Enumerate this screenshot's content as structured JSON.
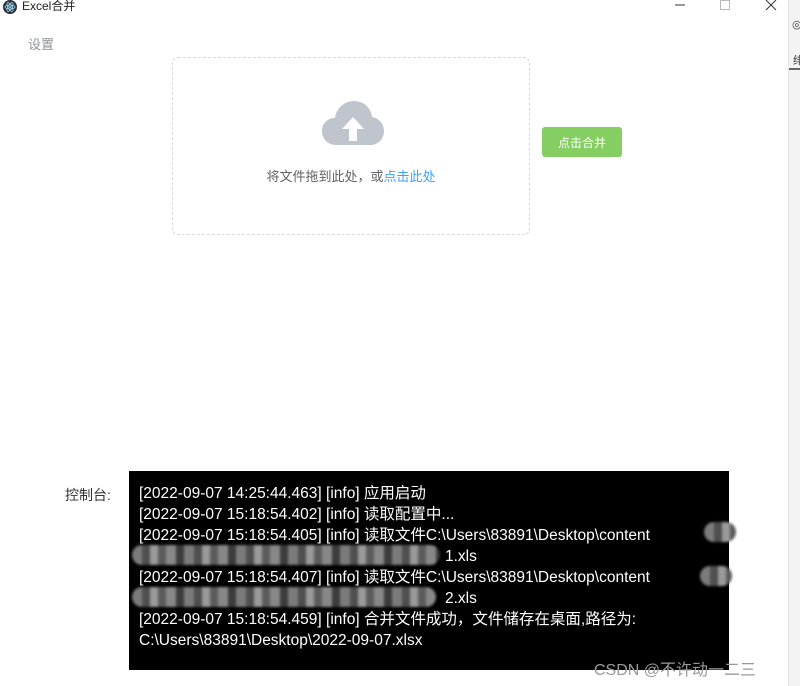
{
  "window": {
    "title": "Excel合并"
  },
  "menu": {
    "settings_label": "设置"
  },
  "upload": {
    "prompt_text": "将文件拖到此处，或",
    "link_text": "点击此处",
    "icon": "upload-cloud-icon"
  },
  "actions": {
    "merge_label": "点击合并",
    "merge_color": "#85ce61"
  },
  "console": {
    "label": "控制台:",
    "lines": [
      "[2022-09-07 14:25:44.463] [info] 应用启动",
      "[2022-09-07 15:18:54.402] [info] 读取配置中...",
      "[2022-09-07 15:18:54.405] [info] 读取文件C:\\Users\\83891\\Desktop\\content",
      "1.xls",
      "[2022-09-07 15:18:54.407] [info] 读取文件C:\\Users\\83891\\Desktop\\content",
      "2.xls",
      "[2022-09-07 15:18:54.459] [info] 合并文件成功，文件储存在桌面,路径为:",
      "C:\\Users\\83891\\Desktop\\2022-09-07.xlsx"
    ]
  },
  "watermark": {
    "text": "CSDN @不许动一二三"
  },
  "edge_fragments": [
    "◎)",
    "绯"
  ]
}
